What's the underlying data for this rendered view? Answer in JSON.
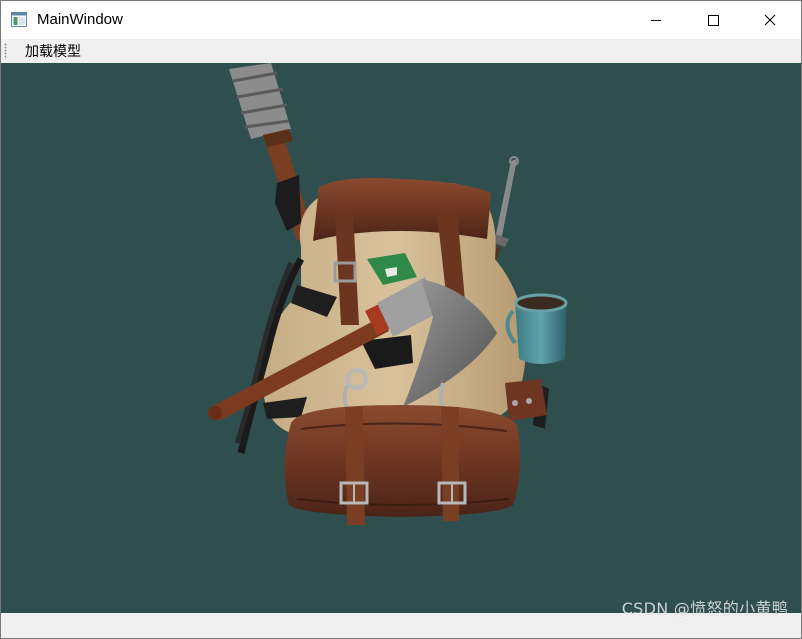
{
  "window": {
    "title": "MainWindow"
  },
  "menu": {
    "items": [
      {
        "label": "加载模型"
      }
    ]
  },
  "viewport": {
    "background": "#2f4f4f",
    "content": "3d-model-render"
  },
  "watermark": {
    "text": "CSDN @愤怒的小黄鸭"
  },
  "icons": {
    "app": "app-window-icon",
    "minimize": "minimize-icon",
    "maximize": "maximize-icon",
    "close": "close-icon"
  }
}
